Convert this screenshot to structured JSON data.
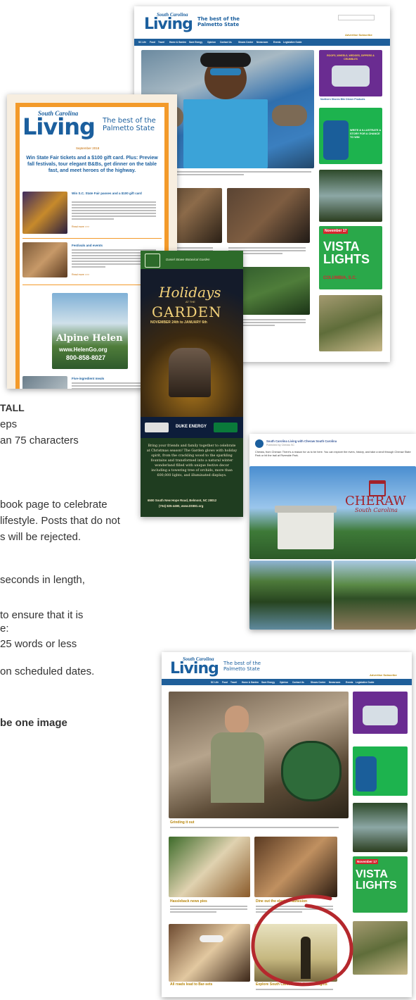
{
  "cutoff_text": {
    "heading": "TALL",
    "line1": "eps",
    "line2": "an 75 characters",
    "para1": "book page to celebrate",
    "para2": "lifestyle. Posts that do not",
    "para3": "s will be rejected.",
    "para4": "seconds in length,",
    "para5": "to ensure that it is",
    "para6": "e:",
    "para7": "25 words or less",
    "para8": "on scheduled dates.",
    "para9": "be one image"
  },
  "website_top": {
    "logo_top": "South Carolina",
    "logo_main": "Living",
    "tagline1": "The best of the",
    "tagline2": "Palmetto State",
    "nav": [
      "SC Life",
      "Food",
      "Travel",
      "Home & Garden",
      "Save Energy",
      "Opinion",
      "Contact Us",
      "Shows Center",
      "Newsroom",
      "Events",
      "Legislative Guide"
    ],
    "subscribe": "Advertise  Subscribe",
    "ad_top": "ROOFS, WHEELS, WEDGES, DIPPERS & CRUMBLES",
    "november": "November 17",
    "vista": "VISTA",
    "lights": "LIGHTS",
    "columbia": "COLUMBIA, S.C.",
    "write": "WRITE & ILLUSTRATE A STORY FOR A CHANCE TO WIN",
    "stripe_text": "Northern Shores Bite Dinner Products"
  },
  "newsletter": {
    "logo_top": "South Carolina",
    "logo_main": "Living",
    "tagline1": "The best of the",
    "tagline2": "Palmetto State",
    "date": "September 2018",
    "headline": "Win State Fair tickets and a $100 gift card. Plus: Preview fall festivals, tour elegant B&Bs, get dinner on the table fast, and meet heroes of the highway.",
    "item1_title": "Win S.C. State Fair passes and a $100 gift card",
    "item2_title": "Festivals and events",
    "item3_title": "Five-ingredient meals",
    "alpine": "Alpine Helen",
    "alpine_url": "www.HelenGo.org",
    "alpine_phone": "800-858-8027",
    "read_more": "Read more >>>"
  },
  "garden_ad": {
    "org": "Daniel Stowe Botanical Garden",
    "holidays": "Holidays",
    "at_the": "AT THE",
    "garden": "GARDEN",
    "dates": "NOVEMBER 24th to JANUARY 6th",
    "duke": "DUKE ENERGY",
    "body": "Bring your friends and family together to celebrate at Christmas season! The Garden glows with holiday spirit, from the crackling wood to the sparkling fountains and transformed into a natural winter wonderland filled with unique festive decor including a towering tree of orchids, more than 600,000 lights, and illuminated displays.",
    "address": "6500 South New Hope Road, Belmont, NC 28012",
    "phone": "(704) 825-4490, www.DSBG.org"
  },
  "facebook": {
    "page": "South Carolina Living with Cheraw South Carolina",
    "meta": "Published by Cheraw SC",
    "post": "Cheraw, from Cheraw: There's a reason for us to be here. You can explore the rivers, history, and take a stroll through Cheraw State Park or hit the trail at Riverside Park.",
    "cheraw": "CHERAW",
    "south_carolina": "South Carolina"
  },
  "website_bottom": {
    "logo_top": "South Carolina",
    "logo_main": "Living",
    "tagline1": "The best of the",
    "tagline2": "Palmetto State",
    "nav": [
      "SC Life",
      "Food",
      "Travel",
      "Home & Garden",
      "Save Energy",
      "Opinion",
      "Contact Us",
      "Shows Center",
      "Newsroom",
      "Events",
      "Legislative Guide"
    ],
    "subscribe": "Advertise  Subscribe",
    "story1": "Grinding it out",
    "story2": "Hassleback news pies",
    "story3": "Dine out the electron adhesion",
    "story4": "All roads lead to Bar-sets",
    "story5": "Explore South Carolina's Halloween nights",
    "november": "November 17",
    "vista": "VISTA",
    "lights": "LIGHTS"
  },
  "colors": {
    "brand_blue": "#1b5f9e",
    "nav_blue": "#1f5f9a",
    "vista_green": "#2aa84a",
    "circle_red": "#b5282d"
  }
}
